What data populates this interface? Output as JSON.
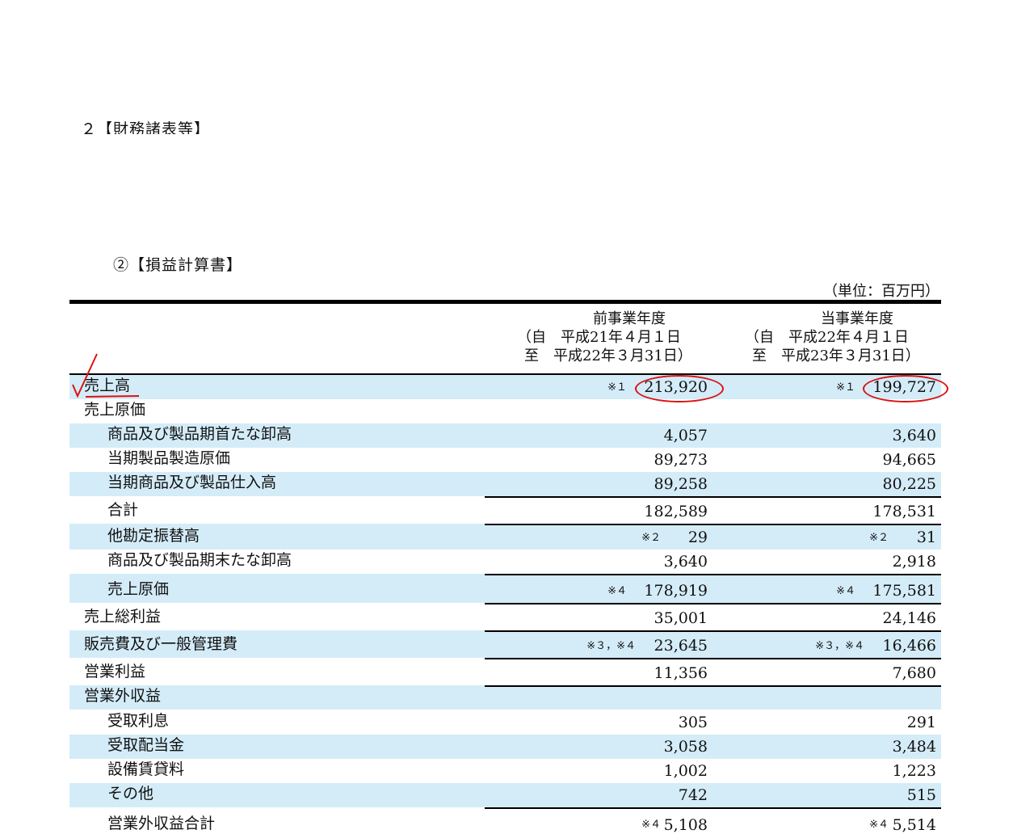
{
  "section_title": "２【財務諸表等】",
  "sub_title": "②【損益計算書】",
  "unit": "（単位：百万円）",
  "columns": {
    "prev": {
      "title": "前事業年度",
      "from": "（自　平成21年４月１日",
      "to": "至　平成22年３月31日）"
    },
    "cur": {
      "title": "当事業年度",
      "from": "（自　平成22年４月１日",
      "to": "至　平成23年３月31日）"
    }
  },
  "rows": [
    {
      "label": "売上高",
      "prev": "213,920",
      "cur": "199,727",
      "prev_note": "※１",
      "cur_note": "※１"
    },
    {
      "label": "売上原価",
      "prev": "",
      "cur": ""
    },
    {
      "label": "商品及び製品期首たな卸高",
      "prev": "4,057",
      "cur": "3,640"
    },
    {
      "label": "当期製品製造原価",
      "prev": "89,273",
      "cur": "94,665"
    },
    {
      "label": "当期商品及び製品仕入高",
      "prev": "89,258",
      "cur": "80,225"
    },
    {
      "label": "合計",
      "prev": "182,589",
      "cur": "178,531"
    },
    {
      "label": "他勘定振替高",
      "prev": "29",
      "cur": "31",
      "prev_note": "※２",
      "cur_note": "※２"
    },
    {
      "label": "商品及び製品期末たな卸高",
      "prev": "3,640",
      "cur": "2,918"
    },
    {
      "label": "売上原価",
      "prev": "178,919",
      "cur": "175,581",
      "prev_note": "※４",
      "cur_note": "※４"
    },
    {
      "label": "売上総利益",
      "prev": "35,001",
      "cur": "24,146"
    },
    {
      "label": "販売費及び一般管理費",
      "prev": "23,645",
      "cur": "16,466",
      "prev_note": "※３，※４",
      "cur_note": "※３，※４"
    },
    {
      "label": "営業利益",
      "prev": "11,356",
      "cur": "7,680"
    },
    {
      "label": "営業外収益",
      "prev": "",
      "cur": ""
    },
    {
      "label": "受取利息",
      "prev": "305",
      "cur": "291"
    },
    {
      "label": "受取配当金",
      "prev": "3,058",
      "cur": "3,484"
    },
    {
      "label": "設備賃貸料",
      "prev": "1,002",
      "cur": "1,223"
    },
    {
      "label": "その他",
      "prev": "742",
      "cur": "515"
    },
    {
      "label": "営業外収益合計",
      "prev": "5,108",
      "cur": "5,514",
      "prev_note": "※４",
      "cur_note": "※４"
    }
  ]
}
